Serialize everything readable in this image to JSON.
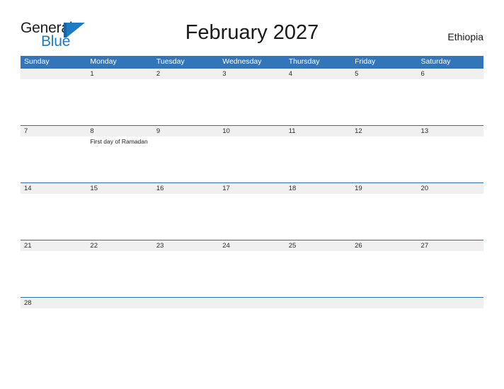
{
  "brand": {
    "name_part1": "General",
    "name_part2": "Blue",
    "mark_icon": "blue-flag-triangle-icon",
    "color_dark": "#1d1d1d",
    "color_blue": "#1f7ac4"
  },
  "header": {
    "title": "February 2027",
    "country": "Ethiopia"
  },
  "theme": {
    "header_blue": "#3275b8",
    "date_band_gray": "#f0f0f0",
    "rule_blue": "#2f6fae",
    "page_background": "#ffffff"
  },
  "calendar": {
    "weekdays": [
      "Sunday",
      "Monday",
      "Tuesday",
      "Wednesday",
      "Thursday",
      "Friday",
      "Saturday"
    ],
    "weeks": [
      {
        "days": [
          {
            "date": "",
            "event": ""
          },
          {
            "date": "1",
            "event": ""
          },
          {
            "date": "2",
            "event": ""
          },
          {
            "date": "3",
            "event": ""
          },
          {
            "date": "4",
            "event": ""
          },
          {
            "date": "5",
            "event": ""
          },
          {
            "date": "6",
            "event": ""
          }
        ]
      },
      {
        "days": [
          {
            "date": "7",
            "event": ""
          },
          {
            "date": "8",
            "event": "First day of Ramadan"
          },
          {
            "date": "9",
            "event": ""
          },
          {
            "date": "10",
            "event": ""
          },
          {
            "date": "11",
            "event": ""
          },
          {
            "date": "12",
            "event": ""
          },
          {
            "date": "13",
            "event": ""
          }
        ]
      },
      {
        "days": [
          {
            "date": "14",
            "event": ""
          },
          {
            "date": "15",
            "event": ""
          },
          {
            "date": "16",
            "event": ""
          },
          {
            "date": "17",
            "event": ""
          },
          {
            "date": "18",
            "event": ""
          },
          {
            "date": "19",
            "event": ""
          },
          {
            "date": "20",
            "event": ""
          }
        ]
      },
      {
        "days": [
          {
            "date": "21",
            "event": ""
          },
          {
            "date": "22",
            "event": ""
          },
          {
            "date": "23",
            "event": ""
          },
          {
            "date": "24",
            "event": ""
          },
          {
            "date": "25",
            "event": ""
          },
          {
            "date": "26",
            "event": ""
          },
          {
            "date": "27",
            "event": ""
          }
        ]
      },
      {
        "days": [
          {
            "date": "28",
            "event": ""
          },
          {
            "date": "",
            "event": ""
          },
          {
            "date": "",
            "event": ""
          },
          {
            "date": "",
            "event": ""
          },
          {
            "date": "",
            "event": ""
          },
          {
            "date": "",
            "event": ""
          },
          {
            "date": "",
            "event": ""
          }
        ]
      }
    ]
  }
}
